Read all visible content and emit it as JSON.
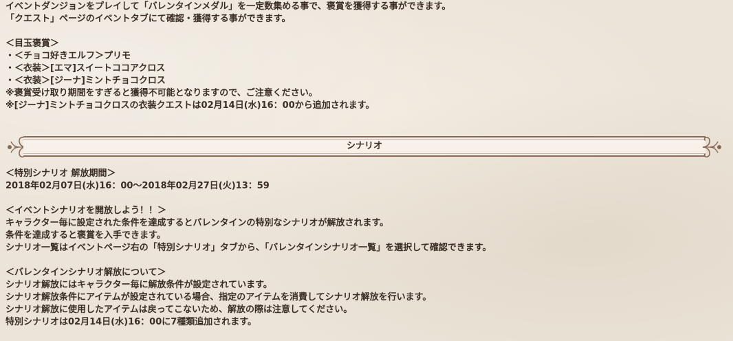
{
  "intro": {
    "line1": "イベントダンジョンをプレイして「バレンタインメダル」を一定数集める事で、褒賞を獲得する事ができます。",
    "line2": "「クエスト」ページのイベントタブにて確認・獲得する事ができます。"
  },
  "rewards": {
    "heading": "＜目玉褒賞＞",
    "items": [
      "・＜チョコ好きエルフ＞プリモ",
      "・＜衣装＞[エマ]スイートココアクロス",
      "・＜衣装＞[ジーナ]ミントチョコクロス"
    ],
    "note1": "※褒賞受け取り期間をすぎると獲得不可能となりますので、ご注意ください。",
    "note2": "※[ジーナ]ミントチョコクロスの衣装クエストは02月14日(水)16：00から追加されます。"
  },
  "section": {
    "title": "シナリオ"
  },
  "scenario_period": {
    "heading": "＜特別シナリオ 解放期間＞",
    "period": "2018年02月07日(水)16：00～2018年02月27日(火)13：59"
  },
  "event_scenario": {
    "heading": "＜イベントシナリオを開放しよう！！＞",
    "line1": "キャラクター毎に設定された条件を達成するとバレンタインの特別なシナリオが解放されます。",
    "line2": "条件を達成すると褒賞を入手できます。",
    "line3": "シナリオ一覧はイベントページ右の「特別シナリオ」タブから、「バレンタインシナリオ一覧」を選択して確認できます。"
  },
  "unlock_info": {
    "heading": "＜バレンタインシナリオ解放について＞",
    "line1": "シナリオ解放にはキャラクター毎に解放条件が設定されています。",
    "line2": "シナリオ解放条件にアイテムが設定されている場合、指定のアイテムを消費してシナリオ解放を行います。",
    "line3": "シナリオ解放に使用したアイテムは戻ってこないため、解放の際は注意してください。",
    "line4": "特別シナリオは02月14日(水)16：00に7種類追加されます。"
  },
  "colors": {
    "background": "#ece4d9",
    "text": "#3a2e27",
    "banner_fill": "#f7f1ea",
    "banner_border": "#8a6a56"
  }
}
